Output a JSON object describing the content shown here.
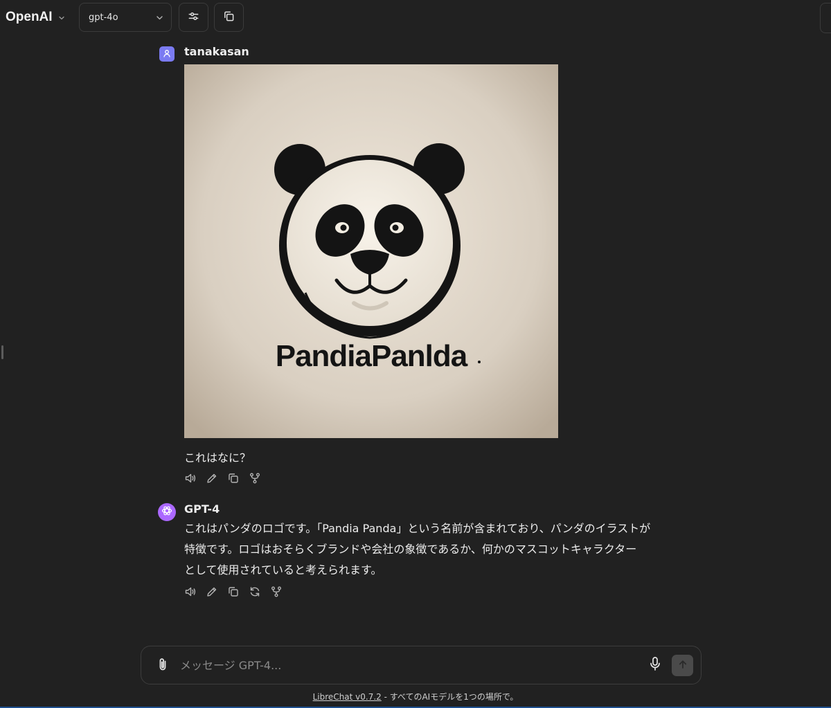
{
  "header": {
    "endpoint_label": "OpenAI",
    "model_label": "gpt-4o",
    "icons": {
      "endpoint_dropdown": "chevron-down-icon",
      "model_dropdown": "chevron-down-icon",
      "settings": "sliders-icon",
      "copy": "copy-icon"
    }
  },
  "conversation": {
    "messages": [
      {
        "sender": "tanakasan",
        "role": "user",
        "avatar_icon": "user-icon",
        "avatar_color": "#7b7bf2",
        "image": {
          "logo_text": "PandiaPanlda",
          "background_color": "#d9cfc1",
          "ink_color": "#141414"
        },
        "text": "これはなに？",
        "actions": [
          "speaker-icon",
          "edit-icon",
          "copy-icon",
          "fork-icon"
        ]
      },
      {
        "sender": "GPT-4",
        "role": "assistant",
        "avatar_icon": "openai-logo-icon",
        "avatar_color": "#ab68ff",
        "text_lines": [
          "これはパンダのロゴです。「Pandia Panda」という名前が含まれており、パンダのイラストが",
          "特徴です。ロゴはおそらくブランドや会社の象徴であるか、何かのマスコットキャラクター",
          "として使用されていると考えられます。"
        ],
        "actions": [
          "speaker-icon",
          "edit-icon",
          "copy-icon",
          "regenerate-icon",
          "fork-icon"
        ]
      }
    ]
  },
  "composer": {
    "placeholder": "メッセージ GPT-4...",
    "value": "",
    "icons": {
      "attach": "paperclip-icon",
      "voice": "microphone-icon",
      "send": "arrow-up-icon"
    }
  },
  "footer": {
    "link_text": "LibreChat v0.7.2",
    "tagline": " - すべてのAIモデルを1つの場所で。"
  },
  "colors": {
    "background": "#212121",
    "border": "#3b3b3b",
    "text": "#ececec",
    "send_button": "#4a4a4a"
  }
}
